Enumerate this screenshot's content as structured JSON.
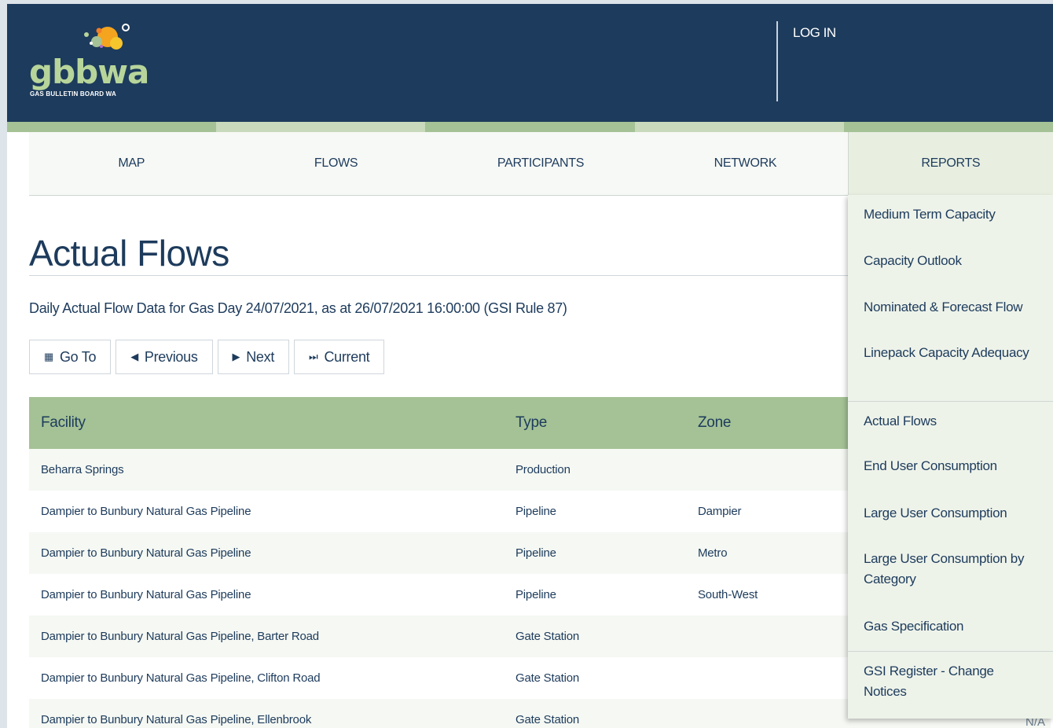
{
  "header": {
    "logo_text": "gbbwa",
    "logo_subtitle": "GAS BULLETIN BOARD WA",
    "login_label": "LOG IN"
  },
  "nav": {
    "items": [
      {
        "label": "MAP"
      },
      {
        "label": "FLOWS"
      },
      {
        "label": "PARTICIPANTS"
      },
      {
        "label": "NETWORK"
      },
      {
        "label": "REPORTS"
      }
    ]
  },
  "main": {
    "title": "Actual Flows",
    "subtitle": "Daily Actual Flow Data for Gas Day 24/07/2021, as at 26/07/2021 16:00:00 (GSI Rule 87)",
    "buttons": {
      "goto": "Go To",
      "previous": "Previous",
      "next": "Next",
      "current": "Current"
    },
    "table": {
      "headers": [
        "Facility",
        "Type",
        "Zone"
      ],
      "rows": [
        [
          "Beharra Springs",
          "Production",
          ""
        ],
        [
          "Dampier to Bunbury Natural Gas Pipeline",
          "Pipeline",
          "Dampier"
        ],
        [
          "Dampier to Bunbury Natural Gas Pipeline",
          "Pipeline",
          "Metro"
        ],
        [
          "Dampier to Bunbury Natural Gas Pipeline",
          "Pipeline",
          "South-West"
        ],
        [
          "Dampier to Bunbury Natural Gas Pipeline, Barter Road",
          "Gate Station",
          ""
        ],
        [
          "Dampier to Bunbury Natural Gas Pipeline, Clifton Road",
          "Gate Station",
          ""
        ],
        [
          "Dampier to Bunbury Natural Gas Pipeline, Ellenbrook",
          "Gate Station",
          ""
        ]
      ],
      "partial_value": "N/A"
    }
  },
  "reports_menu": {
    "items": [
      {
        "label": "Medium Term Capacity"
      },
      {
        "label": "Capacity Outlook"
      },
      {
        "label": "Nominated & Forecast Flow"
      },
      {
        "label": "Linepack Capacity Adequacy"
      },
      {
        "label": "Actual Flows"
      },
      {
        "label": "End User Consumption"
      },
      {
        "label": "Large User Consumption"
      },
      {
        "label": "Large User Consumption by Category"
      },
      {
        "label": "Gas Specification"
      },
      {
        "label": "GSI Register - Change Notices"
      }
    ]
  },
  "colors": {
    "navy": "#1d3b5c",
    "green": "#a4c295",
    "light_green": "#e8efe1"
  }
}
